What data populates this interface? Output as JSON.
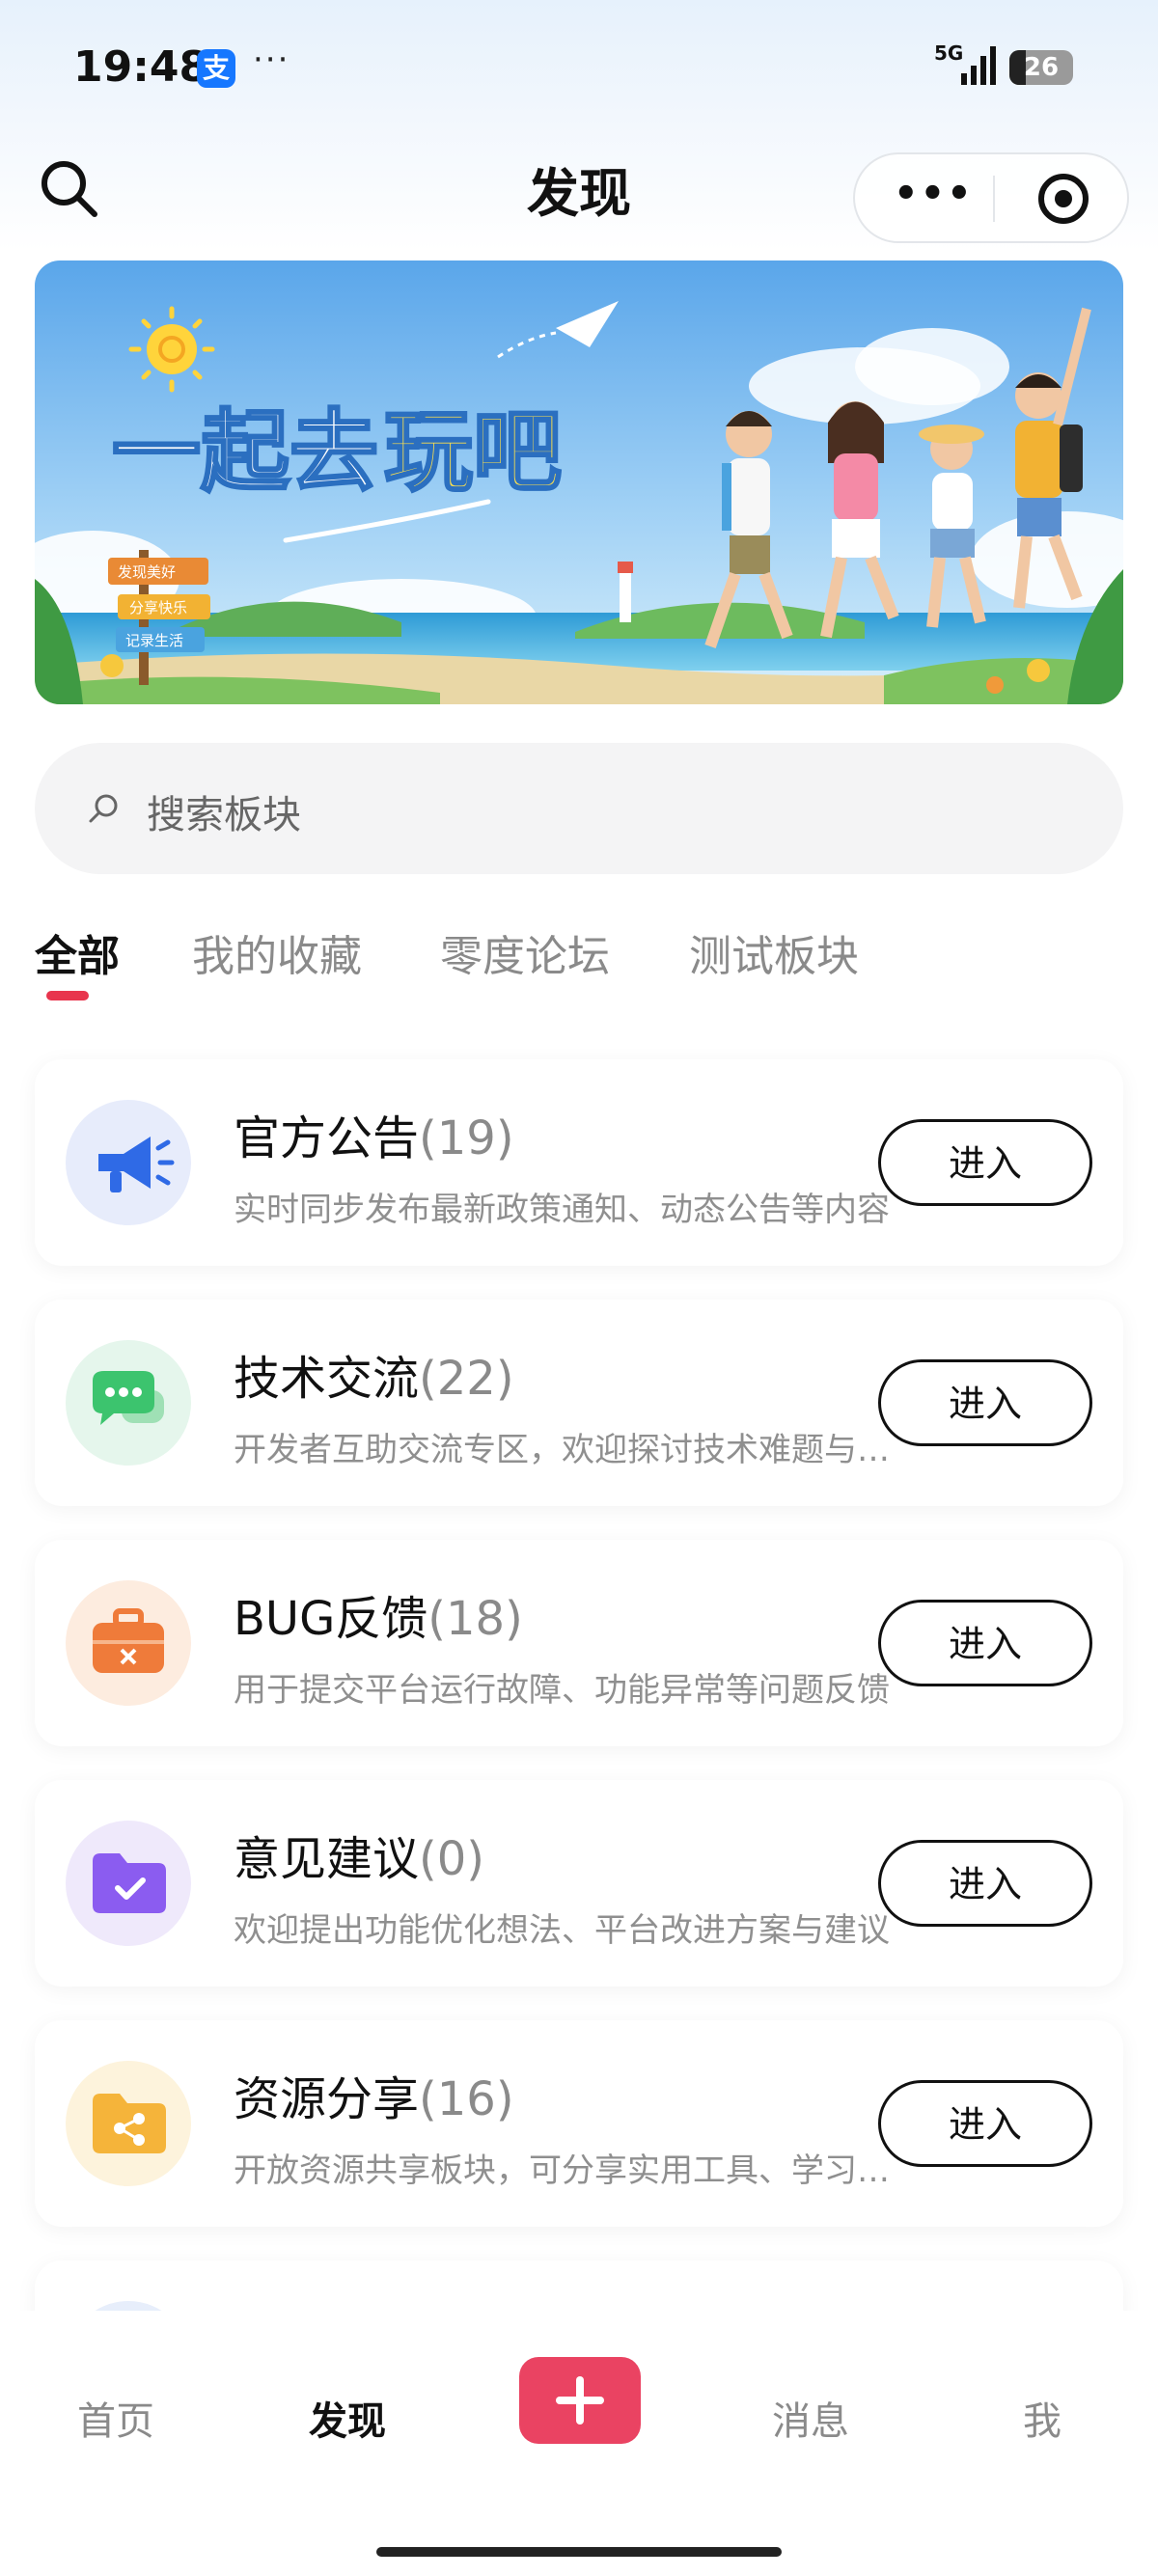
{
  "status_bar": {
    "time": "19:48",
    "alipay_badge": "支",
    "more": "···",
    "network": "5G",
    "battery": "26",
    "battery_level": 0.26
  },
  "nav": {
    "title": "发现"
  },
  "banner": {
    "headline_a": "一起去",
    "headline_b": "玩吧",
    "signs": [
      "发现美好",
      "分享快乐",
      "记录生活"
    ]
  },
  "search": {
    "placeholder": "搜索板块"
  },
  "tabs": [
    {
      "label": "全部",
      "active": true
    },
    {
      "label": "我的收藏",
      "active": false
    },
    {
      "label": "零度论坛",
      "active": false
    },
    {
      "label": "测试板块",
      "active": false
    }
  ],
  "boards": [
    {
      "name": "官方公告",
      "count": "(19)",
      "desc": "实时同步发布最新政策通知、动态公告等内容",
      "button": "进入",
      "icon": "megaphone-icon",
      "icon_bg": "#e7ecfb",
      "icon_color": "#2f6ae6"
    },
    {
      "name": "技术交流",
      "count": "(22)",
      "desc": "开发者互助交流专区，欢迎探讨技术难题与经验",
      "button": "进入",
      "icon": "chat-bubble-icon",
      "icon_bg": "#e5f6ec",
      "icon_color": "#3cc46e"
    },
    {
      "name": "BUG反馈",
      "count": "(18)",
      "desc": "用于提交平台运行故障、功能异常等问题反馈",
      "button": "进入",
      "icon": "toolbox-icon",
      "icon_bg": "#fdecdf",
      "icon_color": "#ef7b3a"
    },
    {
      "name": "意见建议",
      "count": "(0)",
      "desc": "欢迎提出功能优化想法、平台改进方案与建议",
      "button": "进入",
      "icon": "folder-check-icon",
      "icon_bg": "#efe9fb",
      "icon_color": "#8b5cf0"
    },
    {
      "name": "资源分享",
      "count": "(16)",
      "desc": "开放资源共享板块，可分享实用工具、学习资料",
      "button": "进入",
      "icon": "folder-share-icon",
      "icon_bg": "#fdf3dc",
      "icon_color": "#f5b43a"
    }
  ],
  "tabbar": [
    {
      "label": "首页",
      "active": false
    },
    {
      "label": "发现",
      "active": true
    },
    {
      "label": "消息",
      "active": false
    },
    {
      "label": "我",
      "active": false
    }
  ],
  "colors": {
    "accent": "#e8354d",
    "plus_button": "#ea4362"
  }
}
